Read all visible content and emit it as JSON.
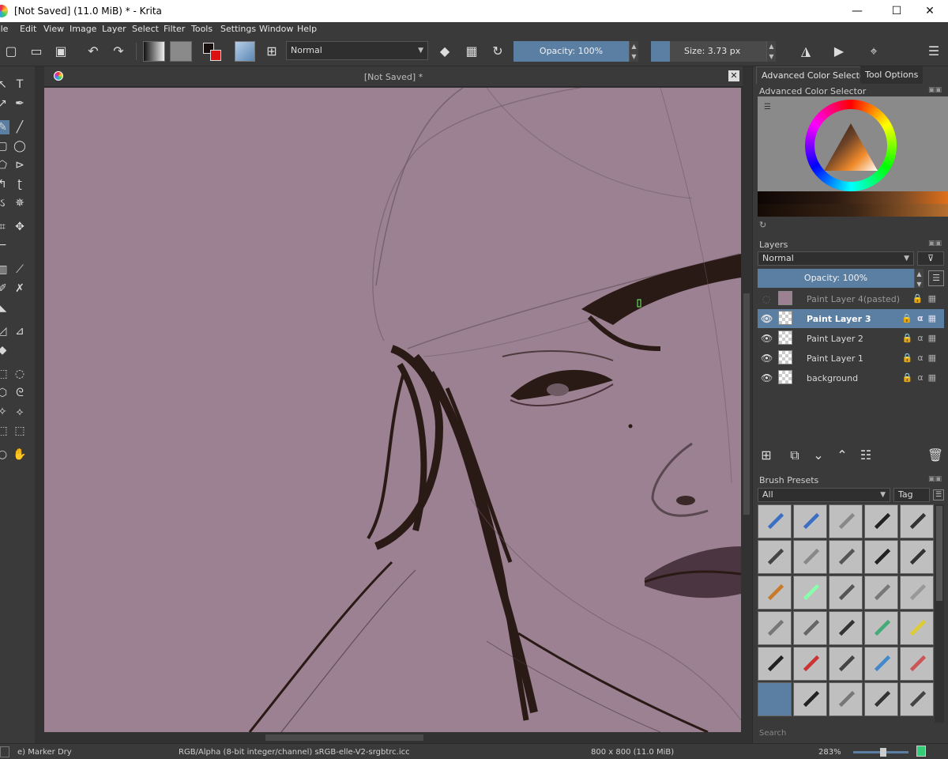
{
  "window": {
    "title": "[Not Saved]  (11.0 MiB)  * - Krita",
    "minimize": "—",
    "maximize": "☐",
    "close": "✕"
  },
  "menu": [
    "File",
    "Edit",
    "View",
    "Image",
    "Layer",
    "Select",
    "Filter",
    "Tools",
    "Settings",
    "Window",
    "Help"
  ],
  "toolbar": {
    "blend_mode": "Normal",
    "opacity_label": "Opacity: 100%",
    "size_label": "Size: 3.73 px"
  },
  "canvas": {
    "doc_title": "[Not Saved]  *",
    "background_color": "#9b8191"
  },
  "docker": {
    "tabs": [
      "Advanced Color Selector",
      "Tool Options"
    ],
    "color_selector_title": "Advanced Color Selector",
    "layers_title": "Layers",
    "layers_blend": "Normal",
    "layers_opacity": "Opacity:  100%",
    "layers": [
      {
        "name": "Paint Layer 4(pasted)",
        "visible": false,
        "selected": false
      },
      {
        "name": "Paint Layer 3",
        "visible": true,
        "selected": true
      },
      {
        "name": "Paint Layer 2",
        "visible": true,
        "selected": false
      },
      {
        "name": "Paint Layer 1",
        "visible": true,
        "selected": false
      },
      {
        "name": "background",
        "visible": true,
        "selected": false
      }
    ],
    "brush_presets_title": "Brush Presets",
    "brush_filter": "All",
    "brush_tag": "Tag",
    "search_placeholder": "Search"
  },
  "status": {
    "brush": "e) Marker Dry",
    "color_space": "RGB/Alpha (8-bit integer/channel)  sRGB-elle-V2-srgbtrc.icc",
    "dimensions": "800 x 800 (11.0 MiB)",
    "zoom": "283%"
  },
  "colors": {
    "accent": "#5b7ea3",
    "panel": "#3a3a3a",
    "dark": "#323232"
  }
}
